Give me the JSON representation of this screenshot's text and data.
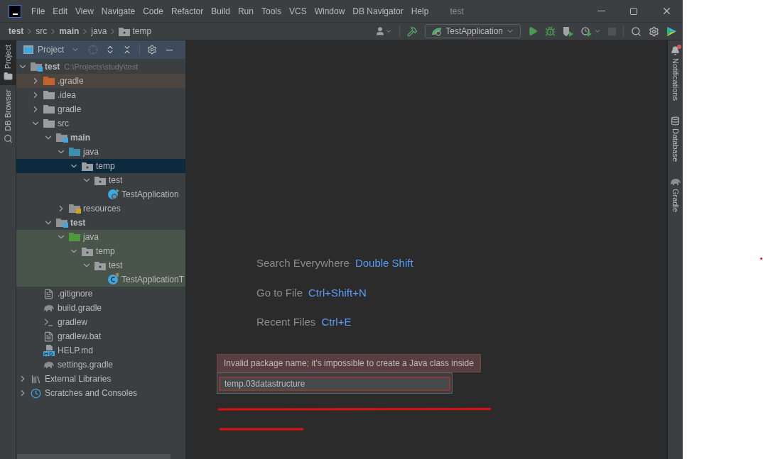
{
  "title_bar": {
    "menus": [
      "File",
      "Edit",
      "View",
      "Navigate",
      "Code",
      "Refactor",
      "Build",
      "Run",
      "Tools",
      "VCS",
      "Window",
      "DB Navigator",
      "Help"
    ],
    "title": "test"
  },
  "breadcrumbs": [
    {
      "label": "test",
      "kind": "module"
    },
    {
      "label": "src",
      "kind": "folder"
    },
    {
      "label": "main",
      "kind": "module"
    },
    {
      "label": "java",
      "kind": "folder"
    },
    {
      "label": "temp",
      "kind": "package"
    }
  ],
  "toolbar": {
    "run_configuration": "TestApplication",
    "stop_disabled": true
  },
  "left_strip": [
    {
      "label": "Project",
      "selected": true,
      "kind": "project"
    },
    {
      "label": "DB Browser",
      "selected": false,
      "kind": "db"
    }
  ],
  "project_panel": {
    "title": "Project",
    "tree": [
      {
        "label": "test",
        "detail": "C:\\Projects\\study\\test",
        "kind": "module",
        "expanded": true,
        "selected": false,
        "children": [
          {
            "label": ".gradle",
            "kind": "excluded",
            "expanded": false,
            "selected": false,
            "excluded": true
          },
          {
            "label": ".idea",
            "kind": "folder",
            "expanded": false,
            "selected": false
          },
          {
            "label": "gradle",
            "kind": "folder",
            "expanded": false,
            "selected": false
          },
          {
            "label": "src",
            "kind": "folder",
            "expanded": true,
            "selected": false,
            "children": [
              {
                "label": "main",
                "kind": "module",
                "expanded": true,
                "selected": false,
                "children": [
                  {
                    "label": "java",
                    "kind": "source",
                    "expanded": true,
                    "selected": false,
                    "children": [
                      {
                        "label": "temp",
                        "kind": "package",
                        "expanded": true,
                        "selected": true,
                        "children": [
                          {
                            "label": "test",
                            "kind": "package",
                            "expanded": true,
                            "selected": false,
                            "children": [
                              {
                                "label": "TestApplication",
                                "kind": "app-class",
                                "selected": false
                              }
                            ]
                          }
                        ]
                      }
                    ]
                  },
                  {
                    "label": "resources",
                    "kind": "resources",
                    "expanded": false,
                    "selected": false
                  }
                ]
              },
              {
                "label": "test",
                "kind": "module",
                "expanded": true,
                "selected": false,
                "children": [
                  {
                    "label": "java",
                    "kind": "test-source",
                    "expanded": true,
                    "selected": false,
                    "test_scope": true,
                    "children": [
                      {
                        "label": "temp",
                        "kind": "package",
                        "expanded": true,
                        "selected": false,
                        "test_scope": true,
                        "children": [
                          {
                            "label": "test",
                            "kind": "package",
                            "expanded": true,
                            "selected": false,
                            "test_scope": true,
                            "children": [
                              {
                                "label": "TestApplicationT",
                                "kind": "test-class",
                                "selected": false,
                                "test_scope": true
                              }
                            ]
                          }
                        ]
                      }
                    ]
                  }
                ]
              }
            ]
          },
          {
            "label": ".gitignore",
            "kind": "ignore",
            "selected": false
          },
          {
            "label": "build.gradle",
            "kind": "gradle",
            "selected": false
          },
          {
            "label": "gradlew",
            "kind": "shell",
            "selected": false
          },
          {
            "label": "gradlew.bat",
            "kind": "text",
            "selected": false
          },
          {
            "label": "HELP.md",
            "kind": "markdown",
            "selected": false
          },
          {
            "label": "settings.gradle",
            "kind": "gradle",
            "selected": false
          }
        ]
      },
      {
        "label": "External Libraries",
        "kind": "libraries",
        "expanded": false,
        "selected": false
      },
      {
        "label": "Scratches and Consoles",
        "kind": "scratches",
        "expanded": false,
        "selected": false
      }
    ]
  },
  "editor_hints": [
    {
      "action": "Search Everywhere",
      "shortcut": "Double Shift"
    },
    {
      "action": "Go to File",
      "shortcut": "Ctrl+Shift+N"
    },
    {
      "action": "Recent Files",
      "shortcut": "Ctrl+E"
    }
  ],
  "new_package_popup": {
    "error": "Invalid package name; it's impossible to create a Java class inside",
    "value": "temp.03datastructure"
  },
  "right_strip": [
    {
      "label": "Notifications",
      "kind": "bell",
      "badge": true
    },
    {
      "label": "Database",
      "kind": "db"
    },
    {
      "label": "Gradle",
      "kind": "gradle"
    }
  ]
}
